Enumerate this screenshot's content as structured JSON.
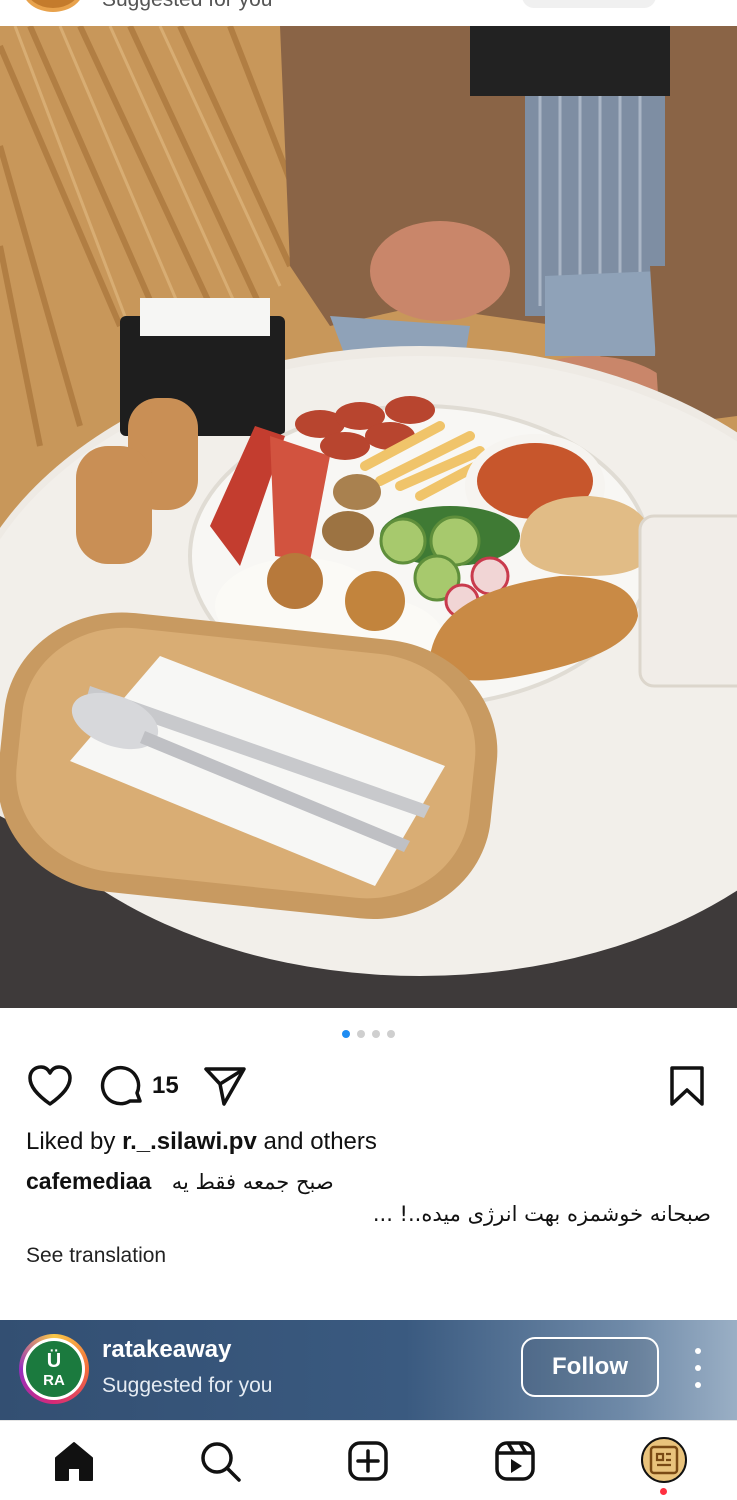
{
  "top_header": {
    "subtitle": "Suggested for you"
  },
  "post": {
    "image_alt": "breakfast plate",
    "carousel": {
      "count": 4,
      "active_index": 0
    },
    "comment_count": "15",
    "liked_by_prefix": "Liked by ",
    "liked_by_user": "r._.silawi.pv",
    "liked_by_suffix": " and others",
    "caption_user": "cafemediaa",
    "caption_line1": "صبح جمعه فقط یه",
    "caption_line2": "صبحانه خوشمزه بهت انرژی میده..! ...",
    "see_translation": "See translation"
  },
  "next_post": {
    "username": "ratakeaway",
    "subtitle": "Suggested for you",
    "follow_label": "Follow",
    "avatar_text": "RA"
  },
  "icons": {
    "like": "heart-icon",
    "comment": "comment-icon",
    "share": "paper-plane-icon",
    "save": "bookmark-icon",
    "home": "home-icon",
    "search": "search-icon",
    "create": "plus-square-icon",
    "reels": "reels-icon",
    "profile": "profile-avatar"
  },
  "colors": {
    "active_dot": "#1e8cf2",
    "notification_dot": "#ff3040",
    "next_header_bg": "#334f72"
  }
}
